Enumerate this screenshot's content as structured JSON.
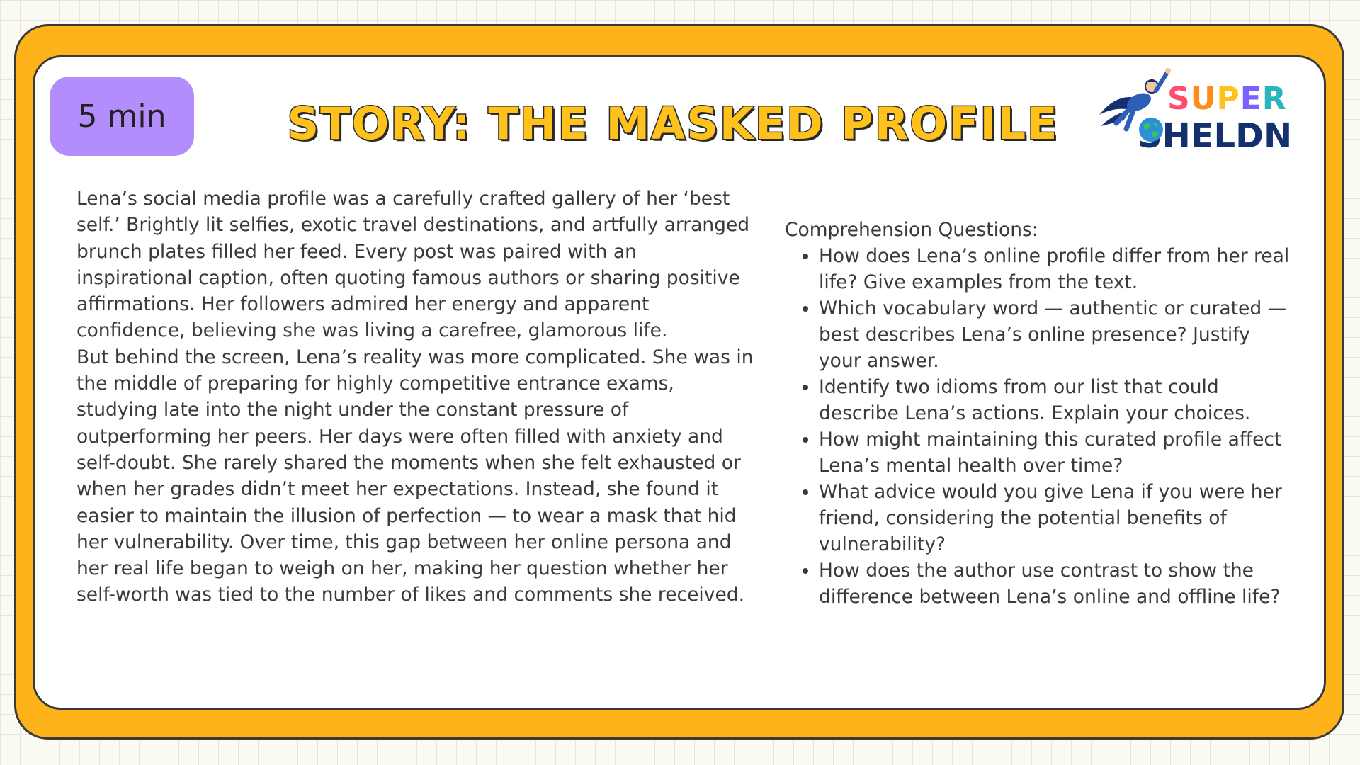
{
  "badge": {
    "time": "5 min"
  },
  "title": "STORY: THE MASKED PROFILE",
  "logo": {
    "super_letters": [
      "S",
      "U",
      "P",
      "E",
      "R"
    ],
    "super_colors": [
      "#ff4d6d",
      "#ff8c1a",
      "#ffc21c",
      "#7b61ff",
      "#2bb3c0"
    ],
    "sheldon_before": "SHELD",
    "sheldon_after": "N",
    "globe_icon": "globe-icon",
    "hero_icon": "flying-superhero-icon"
  },
  "story": {
    "paragraphs": [
      "Lena’s social media profile was a carefully crafted gallery of her ‘best self.’ Brightly lit selfies, exotic travel destinations, and artfully arranged brunch plates filled her feed. Every post was paired with an inspirational caption, often quoting famous authors or sharing positive affirmations. Her followers admired her energy and apparent confidence, believing she was living a carefree, glamorous life.",
      "But behind the screen, Lena’s reality was more complicated. She was in the middle of preparing for highly competitive entrance exams, studying late into the night under the constant pressure of outperforming her peers. Her days were often filled with anxiety and self-doubt. She rarely shared the moments when she felt exhausted or when her grades didn’t meet her expectations. Instead, she found it easier to maintain the illusion of perfection — to wear a mask that hid her vulnerability. Over time, this gap between her online persona and her real life began to weigh on her, making her question whether her self-worth was tied to the number of likes and comments she received."
    ]
  },
  "questions": {
    "heading": "Comprehension Questions:",
    "items": [
      "How does Lena’s online profile differ from her real life? Give examples from the text.",
      "Which vocabulary word — authentic or curated — best describes Lena’s online presence? Justify your answer.",
      "Identify two idioms from our list that could describe Lena’s actions. Explain your choices.",
      "How might maintaining this curated profile affect Lena’s mental health over time?",
      "What advice would you give Lena if you were her friend, considering the potential benefits of vulnerability?",
      "How does the author use contrast to show the difference between Lena’s online and offline life?"
    ]
  },
  "colors": {
    "frame": "#ffb31a",
    "badge": "#b28dfb",
    "title_fill": "#ffc21c",
    "logo_navy": "#14306e"
  }
}
